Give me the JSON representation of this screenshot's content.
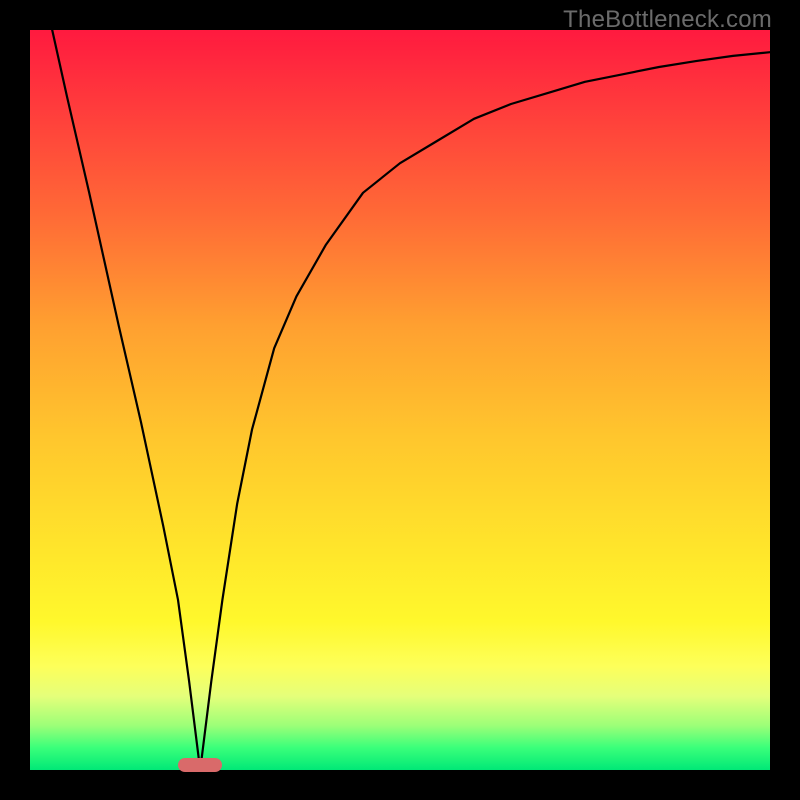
{
  "watermark": "TheBottleneck.com",
  "chart_data": {
    "type": "line",
    "title": "",
    "xlabel": "",
    "ylabel": "",
    "xlim": [
      0,
      100
    ],
    "ylim": [
      0,
      100
    ],
    "grid": false,
    "series": [
      {
        "name": "curve",
        "x": [
          3,
          5,
          8,
          10,
          12,
          15,
          18,
          20,
          21.5,
          23,
          24.5,
          26,
          28,
          30,
          33,
          36,
          40,
          45,
          50,
          55,
          60,
          65,
          70,
          75,
          80,
          85,
          90,
          95,
          100
        ],
        "y": [
          100,
          91,
          78,
          69,
          60,
          47,
          33,
          23,
          12,
          0,
          12,
          23,
          36,
          46,
          57,
          64,
          71,
          78,
          82,
          85,
          88,
          90,
          91.5,
          93,
          94,
          95,
          95.8,
          96.5,
          97
        ]
      }
    ],
    "marker": {
      "x_center": 23,
      "width_pct": 6,
      "color": "#d96a6a"
    },
    "background_gradient": {
      "top": "#ff1a3f",
      "bottom": "#00e877"
    }
  }
}
